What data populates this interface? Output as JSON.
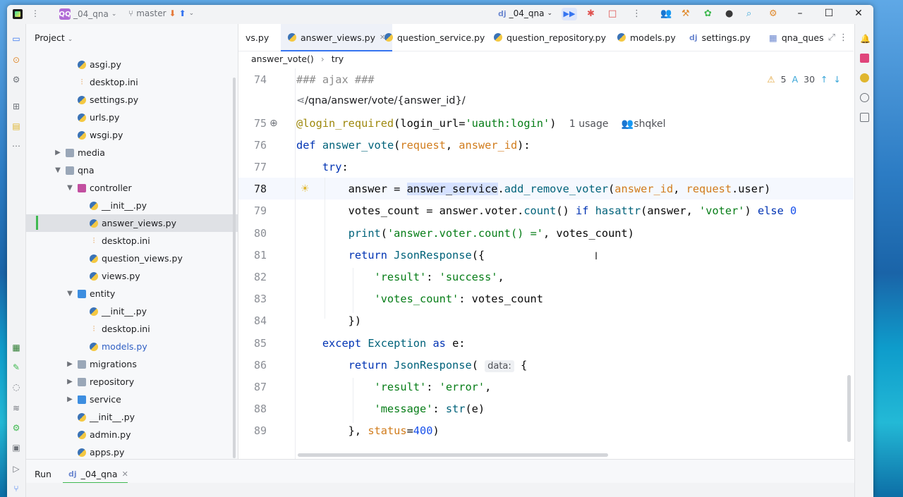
{
  "titlebar": {
    "project_badge": "QQ",
    "project_name": "_04_qna",
    "branch": "master",
    "run_config": "_04_qna"
  },
  "project_panel": {
    "title": "Project",
    "tree": [
      {
        "label": "asgi.py",
        "type": "py",
        "indent": 2
      },
      {
        "label": "desktop.ini",
        "type": "ini",
        "indent": 2
      },
      {
        "label": "settings.py",
        "type": "py",
        "indent": 2
      },
      {
        "label": "urls.py",
        "type": "py",
        "indent": 2
      },
      {
        "label": "wsgi.py",
        "type": "py",
        "indent": 2
      },
      {
        "label": "media",
        "type": "folder",
        "indent": 1,
        "chev": "right"
      },
      {
        "label": "qna",
        "type": "folder",
        "indent": 1,
        "chev": "down"
      },
      {
        "label": "controller",
        "type": "pkg",
        "indent": 2,
        "chev": "down"
      },
      {
        "label": "__init__.py",
        "type": "py",
        "indent": 3
      },
      {
        "label": "answer_views.py",
        "type": "py",
        "indent": 3,
        "selected": true
      },
      {
        "label": "desktop.ini",
        "type": "ini",
        "indent": 3
      },
      {
        "label": "question_views.py",
        "type": "py",
        "indent": 3
      },
      {
        "label": "views.py",
        "type": "py",
        "indent": 3
      },
      {
        "label": "entity",
        "type": "blue",
        "indent": 2,
        "chev": "down"
      },
      {
        "label": "__init__.py",
        "type": "py",
        "indent": 3
      },
      {
        "label": "desktop.ini",
        "type": "ini",
        "indent": 3
      },
      {
        "label": "models.py",
        "type": "py",
        "indent": 3,
        "blue": true
      },
      {
        "label": "migrations",
        "type": "folder",
        "indent": 2,
        "chev": "right"
      },
      {
        "label": "repository",
        "type": "folder",
        "indent": 2,
        "chev": "right"
      },
      {
        "label": "service",
        "type": "blue",
        "indent": 2,
        "chev": "right"
      },
      {
        "label": "__init__.py",
        "type": "py",
        "indent": 2
      },
      {
        "label": "admin.py",
        "type": "py",
        "indent": 2
      },
      {
        "label": "apps.py",
        "type": "py",
        "indent": 2
      }
    ]
  },
  "tabs": [
    {
      "label": "vs.py",
      "icon": "py"
    },
    {
      "label": "answer_views.py",
      "icon": "py",
      "active": true
    },
    {
      "label": "question_service.py",
      "icon": "py"
    },
    {
      "label": "question_repository.py",
      "icon": "py"
    },
    {
      "label": "models.py",
      "icon": "py"
    },
    {
      "label": "settings.py",
      "icon": "dj"
    },
    {
      "label": "qna_ques",
      "icon": "table"
    }
  ],
  "breadcrumb": {
    "func": "answer_vote()",
    "block": "try"
  },
  "inspections": {
    "warnings": "5",
    "typos": "30"
  },
  "editor": {
    "comment_line": "### ajax ###",
    "url_hint": "/qna/answer/vote/{answer_id}/",
    "usage": "1 usage",
    "author": "shqkel",
    "param_hint": "data:"
  },
  "line_numbers": [
    "74",
    "75",
    "76",
    "77",
    "78",
    "79",
    "80",
    "81",
    "82",
    "83",
    "84",
    "85",
    "86",
    "87",
    "88",
    "89"
  ],
  "bottom": {
    "run_label": "Run",
    "run_tab": "_04_qna"
  }
}
